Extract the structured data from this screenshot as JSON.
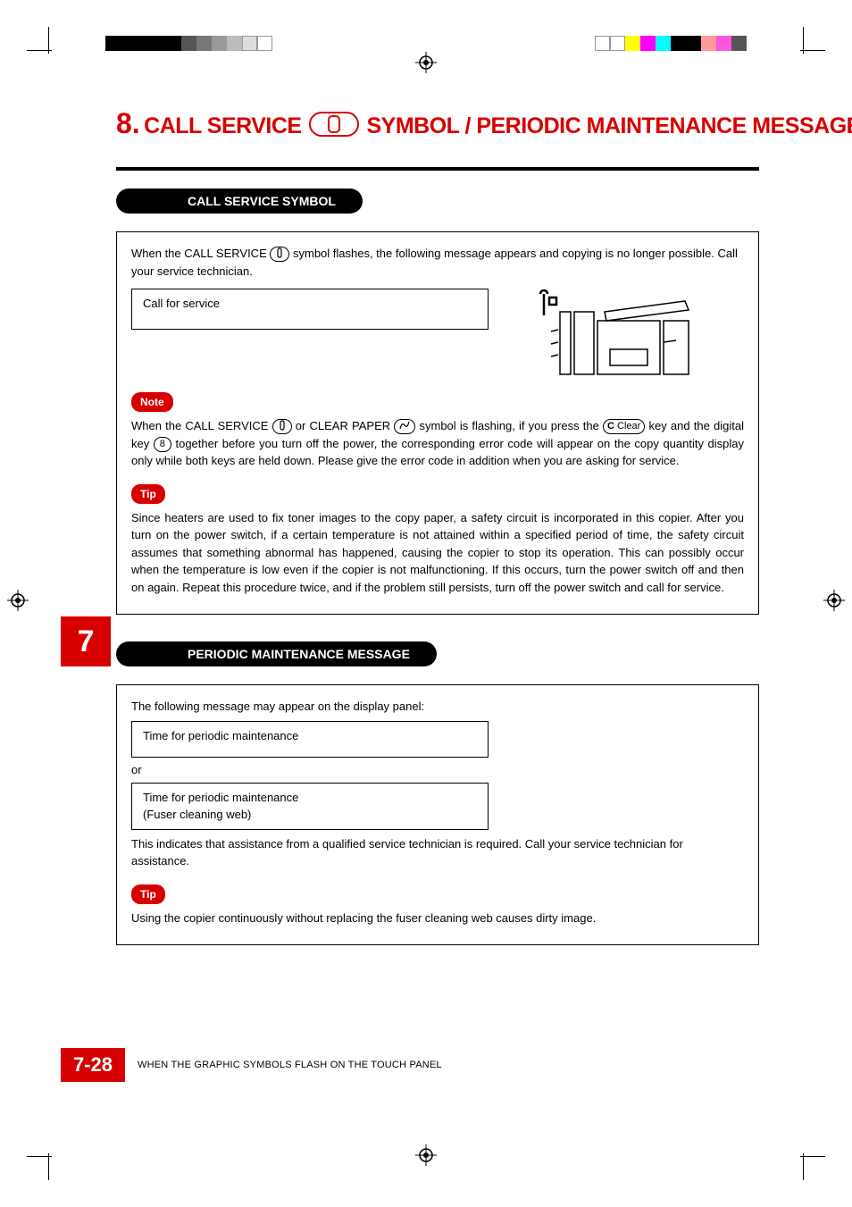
{
  "title": {
    "number": "8.",
    "part1": "CALL SERVICE",
    "part2": "SYMBOL  /   PERIODIC MAINTENANCE MESSAGE"
  },
  "section1": {
    "heading": "CALL SERVICE SYMBOL",
    "intro_a": "When the CALL SERVICE ",
    "intro_b": " symbol flashes, the following message appears and copying is no longer possible. Call your service technician.",
    "message": "Call for service",
    "note_label": "Note",
    "note_a": "When the CALL SERVICE ",
    "note_b": " or CLEAR PAPER ",
    "note_c": " symbol is flashing, if you press the ",
    "note_key_c": "C",
    "note_key_clear": "Clear",
    "note_d": " key and the digital key ",
    "note_key_8": "8",
    "note_e": " together before you turn off the power, the corresponding error code will appear on the copy quantity display only while both keys are held down. Please give the error code in addition when you are asking for service.",
    "tip_label": "Tip",
    "tip_text": "Since heaters are used to fix toner images to the copy paper, a safety circuit is incorporated in this copier. After you turn on the power switch, if a certain temperature is not attained within a specified period of time, the safety circuit assumes that something abnormal has happened, causing the copier to stop its operation. This can possibly occur when the temperature is low even if the copier is not malfunctioning. If this occurs, turn the power switch off and then on again. Repeat this procedure twice, and if the problem still persists, turn off the power switch and call for service."
  },
  "section2": {
    "heading": "PERIODIC MAINTENANCE MESSAGE",
    "intro": "The following message may appear on the display panel:",
    "message1": "Time for periodic maintenance",
    "or": "or",
    "message2_l1": "Time for periodic maintenance",
    "message2_l2": "(Fuser cleaning web)",
    "assist_text": "This indicates that assistance from a qualified service technician is required. Call your service technician for assistance.",
    "tip_label": "Tip",
    "tip_text": "Using the copier continuously without replacing the fuser cleaning web causes dirty image."
  },
  "side_tab": "7",
  "footer": {
    "page": "7-28",
    "text": "WHEN THE GRAPHIC SYMBOLS FLASH ON THE TOUCH PANEL"
  },
  "colors": {
    "left": [
      "#000",
      "#000",
      "#000",
      "#000",
      "#000",
      "#666",
      "#888",
      "#aaa",
      "#ccc",
      "#fff",
      "#fff"
    ],
    "right": [
      "#fff",
      "#fff",
      "#ff0",
      "#f0f",
      "#0ff",
      "#000",
      "#000",
      "#f99",
      "#f0f",
      "#000"
    ]
  }
}
